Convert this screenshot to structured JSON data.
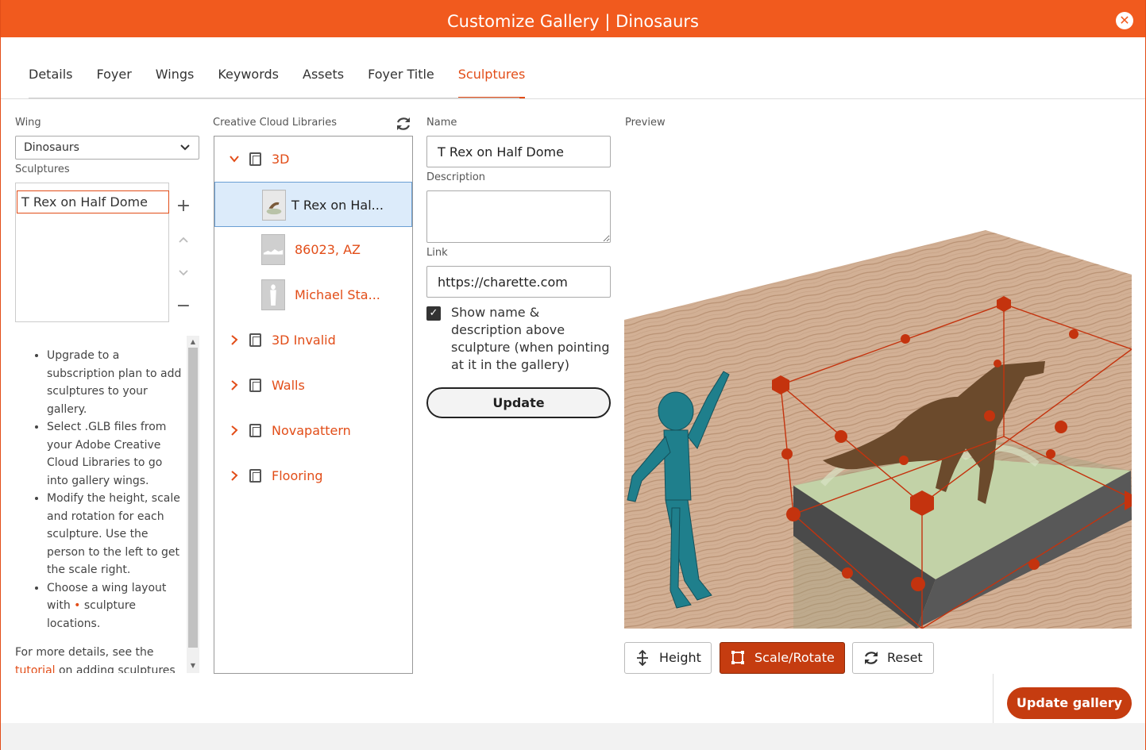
{
  "window": {
    "title": "Customize Gallery | Dinosaurs",
    "close_icon": "close-icon"
  },
  "tabs": [
    {
      "label": "Details"
    },
    {
      "label": "Foyer"
    },
    {
      "label": "Wings"
    },
    {
      "label": "Keywords"
    },
    {
      "label": "Assets"
    },
    {
      "label": "Foyer Title"
    },
    {
      "label": "Sculptures",
      "active": true
    }
  ],
  "left": {
    "wing_label": "Wing",
    "wing_value": "Dinosaurs",
    "sculptures_label": "Sculptures",
    "sculptures": [
      "T Rex on Half Dome"
    ],
    "help_items": [
      "Upgrade to a subscription plan to add sculptures to your gallery.",
      "Select .GLB files from your Adobe Creative Cloud Libraries to go into gallery wings.",
      "Modify the height, scale and rotation for each sculpture. Use the person to the left to get the scale right."
    ],
    "help_last_pre": "Choose a wing layout with ",
    "help_last_dot": "•",
    "help_last_post": " sculpture locations.",
    "more_pre": "For more details, see the ",
    "more_link": "tutorial",
    "more_post": " on adding sculptures to"
  },
  "libraries": {
    "label": "Creative Cloud Libraries",
    "nodes": [
      {
        "label": "3D",
        "expanded": true
      },
      {
        "label": "T Rex on Hal...",
        "selected": true
      },
      {
        "label": "86023, AZ"
      },
      {
        "label": "Michael Sta..."
      },
      {
        "label": "3D Invalid"
      },
      {
        "label": "Walls"
      },
      {
        "label": "Novapattern"
      },
      {
        "label": "Flooring"
      }
    ]
  },
  "form": {
    "name_label": "Name",
    "name_value": "T Rex on Half Dome",
    "description_label": "Description",
    "description_value": "",
    "link_label": "Link",
    "link_value": "https://charette.com",
    "show_checkbox_checked": true,
    "show_checkbox_label": "Show name & description above sculpture (when pointing at it in the gallery)",
    "update_label": "Update"
  },
  "preview": {
    "label": "Preview",
    "height_label": "Height",
    "scale_rotate_label": "Scale/Rotate",
    "reset_label": "Reset"
  },
  "footer": {
    "update_gallery_label": "Update gallery"
  },
  "colors": {
    "accent": "#f15a1e",
    "accent_dark": "#c53c10"
  }
}
